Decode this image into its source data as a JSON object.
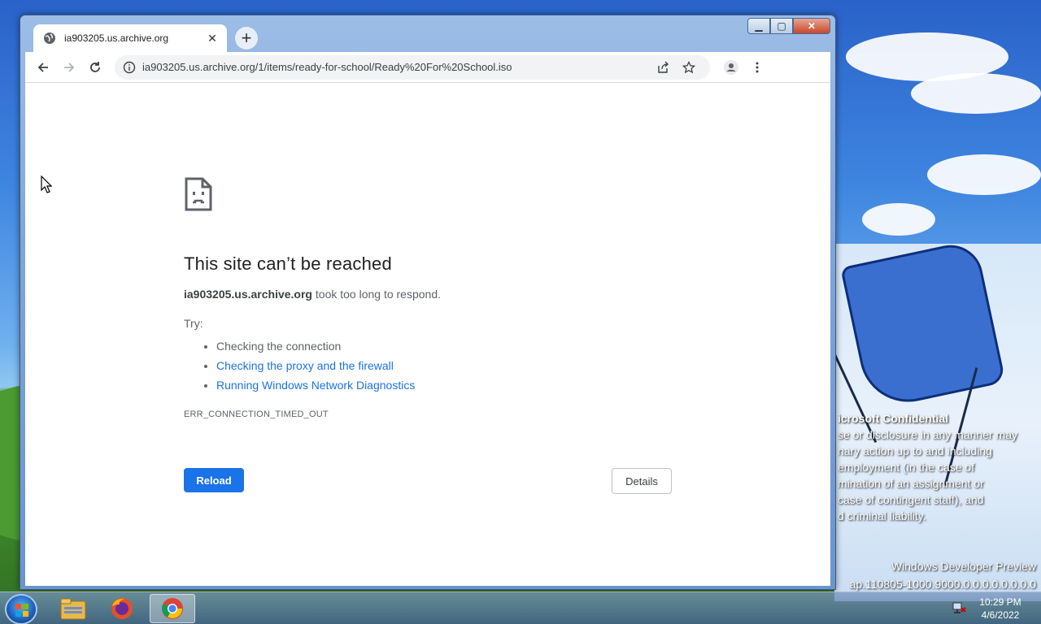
{
  "browser": {
    "tab": {
      "title": "ia903205.us.archive.org",
      "favicon": "globe-icon"
    },
    "new_tab_label": "+",
    "address_bar": {
      "url": "ia903205.us.archive.org/1/items/ready-for-school/Ready%20For%20School.iso"
    },
    "window_controls": {
      "minimize": "▁",
      "maximize": "▢",
      "close": "✕"
    }
  },
  "error_page": {
    "title": "This site can’t be reached",
    "host": "ia903205.us.archive.org",
    "message": " took too long to respond.",
    "try_label": "Try:",
    "suggestions": [
      {
        "text": "Checking the connection",
        "link": false
      },
      {
        "text": "Checking the proxy and the firewall",
        "link": true
      },
      {
        "text": "Running Windows Network Diagnostics",
        "link": true
      }
    ],
    "error_code": "ERR_CONNECTION_TIMED_OUT",
    "reload_label": "Reload",
    "details_label": "Details"
  },
  "desktop": {
    "watermark": {
      "title": "icrosoft Confidential",
      "lines": [
        "se or disclosure in any manner may",
        "nary action up to and including",
        "employment (in the case of",
        "mination of an assignment or",
        "case of contingent staff), and",
        "d criminal liability."
      ]
    },
    "build_line1": "Windows Developer Preview",
    "build_line2": "ap.110805-1000.9000.0.0.0.0.0.0.0.0"
  },
  "taskbar": {
    "apps": [
      "file-explorer-icon",
      "firefox-icon",
      "chrome-icon"
    ],
    "clock_time": "10:29 PM",
    "clock_date": "4/6/2022"
  },
  "colors": {
    "accent": "#1a73e8",
    "link": "#1a73e8",
    "text": "#5f6368",
    "title": "#202124"
  }
}
